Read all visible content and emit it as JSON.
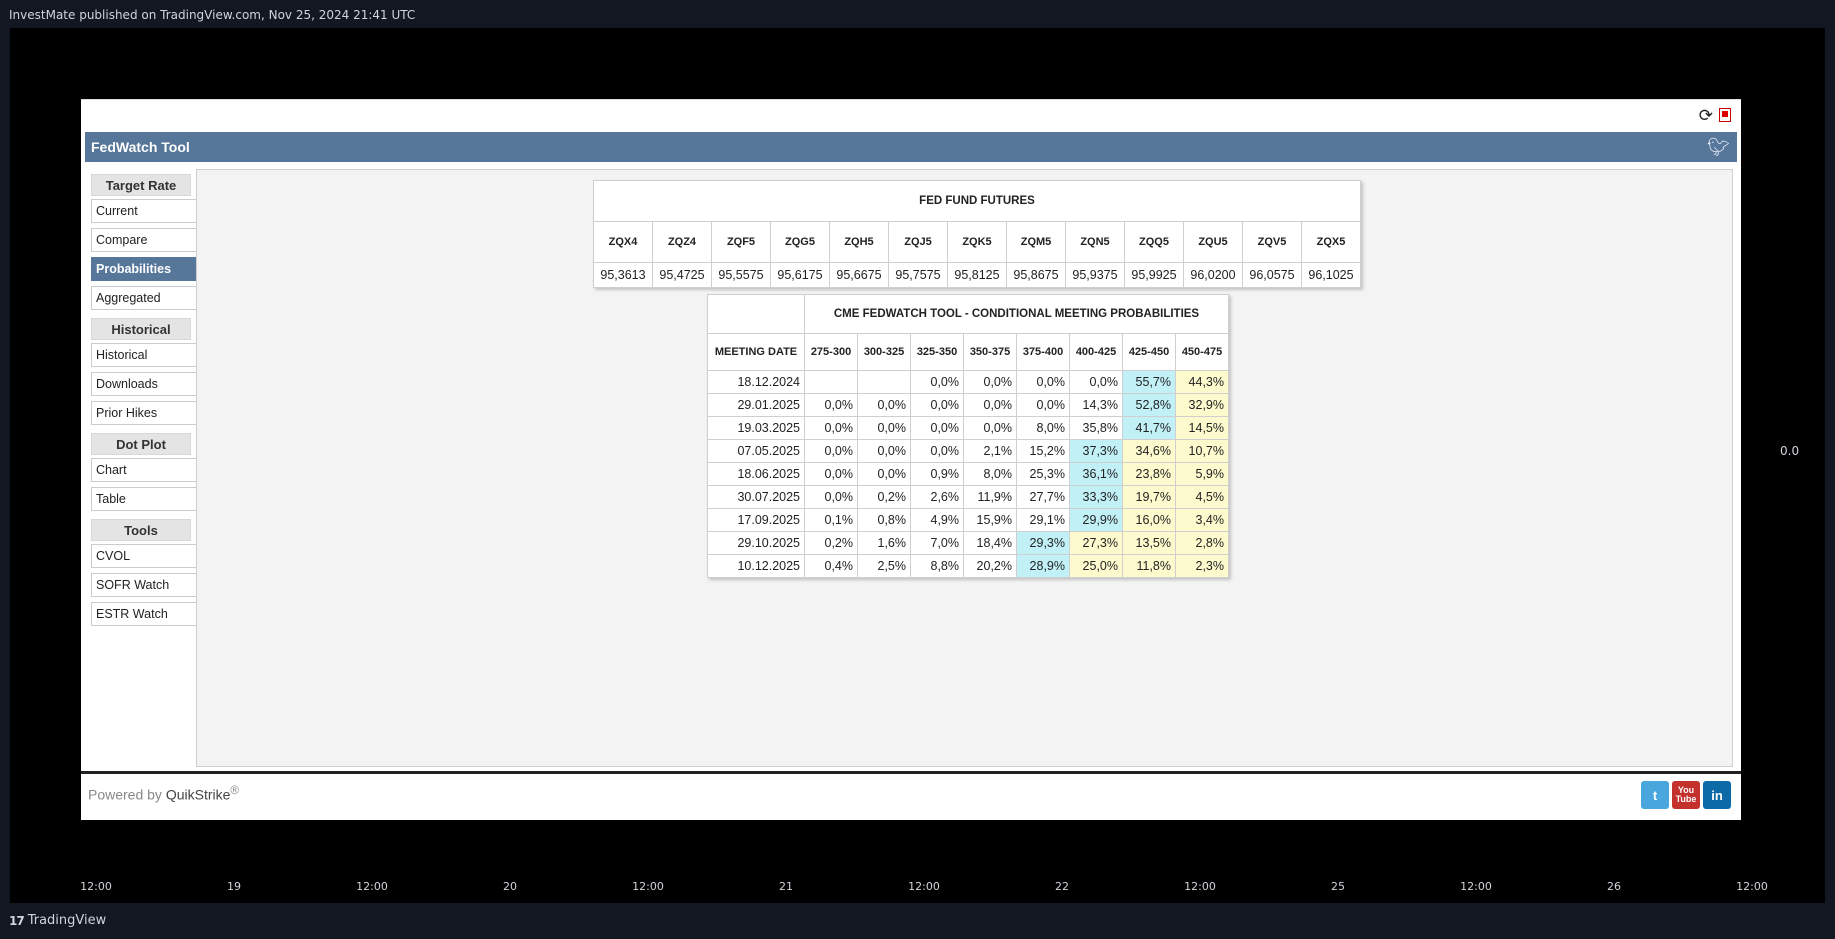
{
  "publisher": "InvestMate published on TradingView.com, Nov 25, 2024 21:41 UTC",
  "right_value": "0.0",
  "time_axis": [
    "12:00",
    "19",
    "12:00",
    "20",
    "12:00",
    "21",
    "12:00",
    "22",
    "12:00",
    "25",
    "12:00",
    "26",
    "12:00"
  ],
  "tv_brand": "TradingView",
  "fedwatch": {
    "title": "FedWatch Tool",
    "sidebar": [
      {
        "head": "Target Rate",
        "items": [
          "Current",
          "Compare",
          "Probabilities",
          "Aggregated"
        ]
      },
      {
        "head": "Historical",
        "items": [
          "Historical",
          "Downloads",
          "Prior Hikes"
        ]
      },
      {
        "head": "Dot Plot",
        "items": [
          "Chart",
          "Table"
        ]
      },
      {
        "head": "Tools",
        "items": [
          "CVOL",
          "SOFR Watch",
          "ESTR Watch"
        ]
      }
    ],
    "active_item": "Probabilities",
    "futures": {
      "title": "FED FUND FUTURES",
      "codes": [
        "ZQX4",
        "ZQZ4",
        "ZQF5",
        "ZQG5",
        "ZQH5",
        "ZQJ5",
        "ZQK5",
        "ZQM5",
        "ZQN5",
        "ZQQ5",
        "ZQU5",
        "ZQV5",
        "ZQX5"
      ],
      "values": [
        "95,3613",
        "95,4725",
        "95,5575",
        "95,6175",
        "95,6675",
        "95,7575",
        "95,8125",
        "95,8675",
        "95,9375",
        "95,9925",
        "96,0200",
        "96,0575",
        "96,1025"
      ]
    },
    "probabilities": {
      "title": "CME FEDWATCH TOOL - CONDITIONAL MEETING PROBABILITIES",
      "date_header": "MEETING DATE",
      "ranges": [
        "275-300",
        "300-325",
        "325-350",
        "350-375",
        "375-400",
        "400-425",
        "425-450",
        "450-475"
      ],
      "rows": [
        {
          "date": "18.12.2024",
          "vals": [
            "",
            "",
            "0,0%",
            "0,0%",
            "0,0%",
            "0,0%",
            "55,7%",
            "44,3%"
          ],
          "hl": [
            "",
            "",
            "",
            "",
            "",
            "",
            "b",
            "y"
          ]
        },
        {
          "date": "29.01.2025",
          "vals": [
            "0,0%",
            "0,0%",
            "0,0%",
            "0,0%",
            "0,0%",
            "14,3%",
            "52,8%",
            "32,9%"
          ],
          "hl": [
            "",
            "",
            "",
            "",
            "",
            "",
            "b",
            "y"
          ]
        },
        {
          "date": "19.03.2025",
          "vals": [
            "0,0%",
            "0,0%",
            "0,0%",
            "0,0%",
            "8,0%",
            "35,8%",
            "41,7%",
            "14,5%"
          ],
          "hl": [
            "",
            "",
            "",
            "",
            "",
            "",
            "b",
            "y"
          ]
        },
        {
          "date": "07.05.2025",
          "vals": [
            "0,0%",
            "0,0%",
            "0,0%",
            "2,1%",
            "15,2%",
            "37,3%",
            "34,6%",
            "10,7%"
          ],
          "hl": [
            "",
            "",
            "",
            "",
            "",
            "b",
            "y",
            "y"
          ]
        },
        {
          "date": "18.06.2025",
          "vals": [
            "0,0%",
            "0,0%",
            "0,9%",
            "8,0%",
            "25,3%",
            "36,1%",
            "23,8%",
            "5,9%"
          ],
          "hl": [
            "",
            "",
            "",
            "",
            "",
            "b",
            "y",
            "y"
          ]
        },
        {
          "date": "30.07.2025",
          "vals": [
            "0,0%",
            "0,2%",
            "2,6%",
            "11,9%",
            "27,7%",
            "33,3%",
            "19,7%",
            "4,5%"
          ],
          "hl": [
            "",
            "",
            "",
            "",
            "",
            "b",
            "y",
            "y"
          ]
        },
        {
          "date": "17.09.2025",
          "vals": [
            "0,1%",
            "0,8%",
            "4,9%",
            "15,9%",
            "29,1%",
            "29,9%",
            "16,0%",
            "3,4%"
          ],
          "hl": [
            "",
            "",
            "",
            "",
            "",
            "b",
            "y",
            "y"
          ]
        },
        {
          "date": "29.10.2025",
          "vals": [
            "0,2%",
            "1,6%",
            "7,0%",
            "18,4%",
            "29,3%",
            "27,3%",
            "13,5%",
            "2,8%"
          ],
          "hl": [
            "",
            "",
            "",
            "",
            "b",
            "y",
            "y",
            "y"
          ]
        },
        {
          "date": "10.12.2025",
          "vals": [
            "0,4%",
            "2,5%",
            "8,8%",
            "20,2%",
            "28,9%",
            "25,0%",
            "11,8%",
            "2,3%"
          ],
          "hl": [
            "",
            "",
            "",
            "",
            "b",
            "y",
            "y",
            "y"
          ]
        }
      ]
    },
    "footer": {
      "powered_by": "Powered by",
      "brand": "QuikStrike",
      "registered": "®"
    },
    "social": [
      "twitter",
      "youtube",
      "linkedin"
    ],
    "youtube_label": "You Tube",
    "linkedin_label": "in",
    "twitter_glyph": "t"
  },
  "colors": {
    "header": "#56769a",
    "highlight_blue": "#c2f0f7",
    "highlight_yellow": "#fdfbce"
  }
}
